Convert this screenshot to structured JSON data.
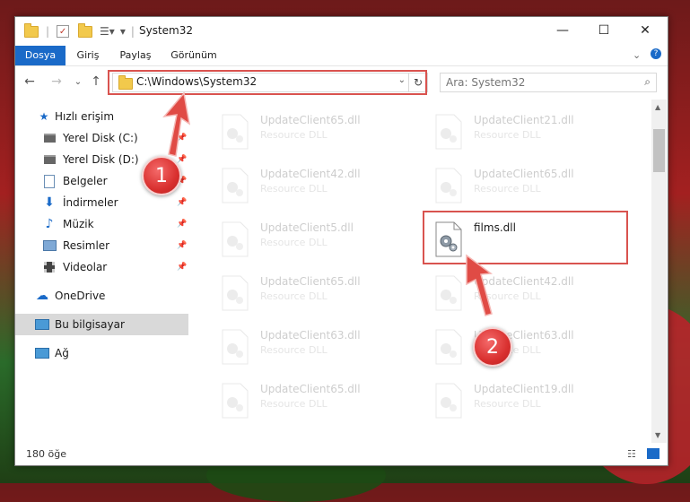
{
  "window": {
    "title": "System32",
    "minimize": "—",
    "maximize": "☐",
    "close": "✕"
  },
  "ribbon": {
    "tabs": [
      {
        "label": "Dosya",
        "active": true
      },
      {
        "label": "Giriş"
      },
      {
        "label": "Paylaş"
      },
      {
        "label": "Görünüm"
      }
    ]
  },
  "navbar": {
    "back": "←",
    "forward": "→",
    "recent": "⌄",
    "up": "↑",
    "address": "C:\\Windows\\System32",
    "refresh": "↻",
    "search_placeholder": "Ara: System32",
    "search_icon": "⌕"
  },
  "sidebar": {
    "items": [
      {
        "label": "Hızlı erişim",
        "icon": "star-icon"
      },
      {
        "label": "Yerel Disk (C:)",
        "icon": "drive-icon",
        "pinned": true
      },
      {
        "label": "Yerel Disk (D:)",
        "icon": "drive-icon",
        "pinned": true
      },
      {
        "label": "Belgeler",
        "icon": "documents-icon",
        "pinned": true
      },
      {
        "label": "İndirmeler",
        "icon": "download-icon",
        "pinned": true
      },
      {
        "label": "Müzik",
        "icon": "music-icon",
        "pinned": true
      },
      {
        "label": "Resimler",
        "icon": "pictures-icon",
        "pinned": true
      },
      {
        "label": "Videolar",
        "icon": "video-icon",
        "pinned": true
      },
      {
        "label": "OneDrive",
        "icon": "cloud-icon"
      },
      {
        "label": "Bu bilgisayar",
        "icon": "computer-icon",
        "selected": true
      },
      {
        "label": "Ağ",
        "icon": "network-icon"
      }
    ]
  },
  "files": [
    {
      "name": "UpdateClient65.dll",
      "type": "Resource DLL",
      "faded": true
    },
    {
      "name": "UpdateClient21.dll",
      "type": "Resource DLL",
      "faded": true
    },
    {
      "name": "UpdateClient42.dll",
      "type": "Resource DLL",
      "faded": true
    },
    {
      "name": "UpdateClient65.dll",
      "type": "Resource DLL",
      "faded": true
    },
    {
      "name": "UpdateClient5.dll",
      "type": "Resource DLL",
      "faded": true
    },
    {
      "name": "films.dll",
      "type": "",
      "faded": false
    },
    {
      "name": "UpdateClient65.dll",
      "type": "Resource DLL",
      "faded": true
    },
    {
      "name": "UpdateClient42.dll",
      "type": "Resource DLL",
      "faded": true
    },
    {
      "name": "UpdateClient63.dll",
      "type": "Resource DLL",
      "faded": true
    },
    {
      "name": "UpdateClient63.dll",
      "type": "Resource DLL",
      "faded": true
    },
    {
      "name": "UpdateClient65.dll",
      "type": "Resource DLL",
      "faded": true
    },
    {
      "name": "UpdateClient19.dll",
      "type": "Resource DLL",
      "faded": true
    }
  ],
  "status": {
    "item_count": "180 öğe"
  },
  "annotations": {
    "step1": "1",
    "step2": "2",
    "color": "#d9534f"
  }
}
